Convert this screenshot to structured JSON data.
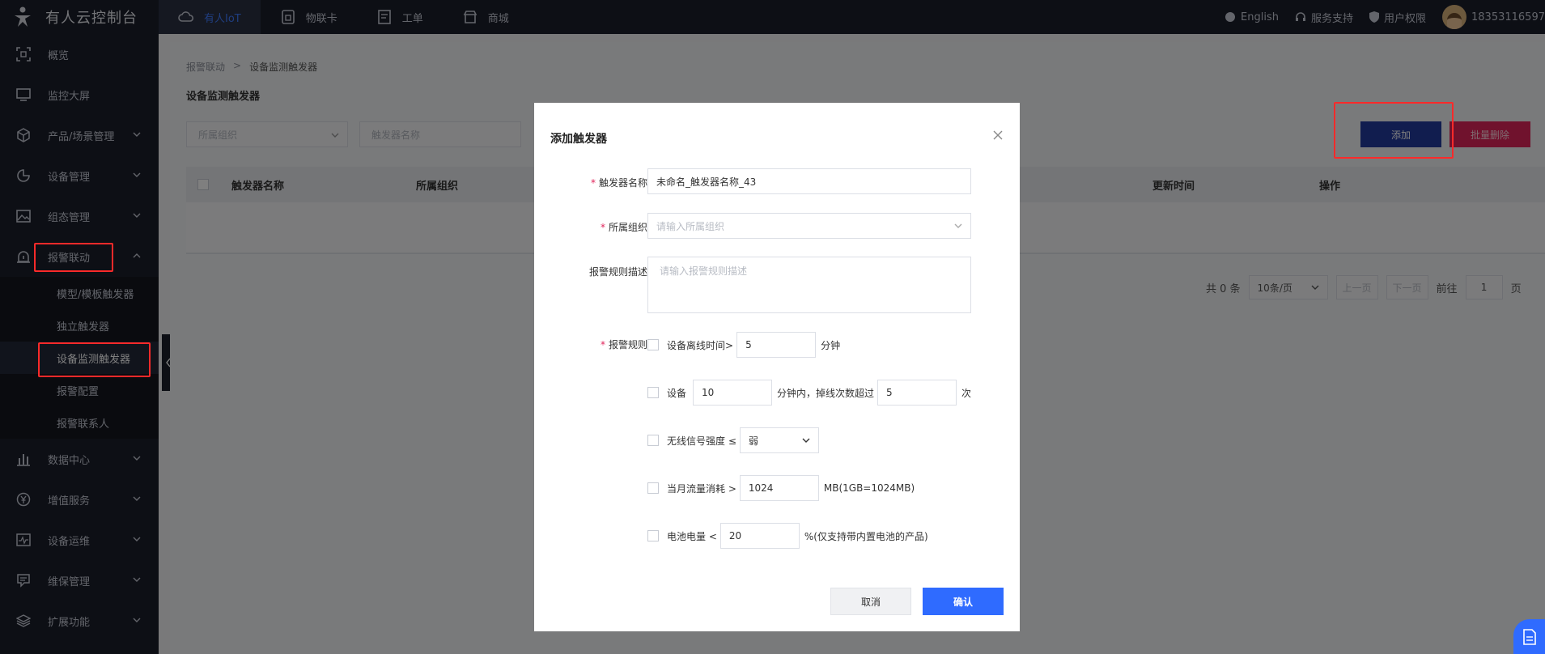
{
  "header": {
    "brand_title": "有人云控制台",
    "nav": [
      {
        "label": "有人IoT",
        "icon": "cloud-icon",
        "active": true
      },
      {
        "label": "物联卡",
        "icon": "sim-card-icon",
        "active": false
      },
      {
        "label": "工单",
        "icon": "ticket-icon",
        "active": false
      },
      {
        "label": "商城",
        "icon": "store-icon",
        "active": false
      }
    ],
    "right": {
      "language": "English",
      "support": "服务支持",
      "permission": "用户权限",
      "username": "18353116597"
    }
  },
  "sidebar": {
    "items": [
      {
        "label": "概览",
        "icon": "overview-icon"
      },
      {
        "label": "监控大屏",
        "icon": "monitor-icon"
      },
      {
        "label": "产品/场景管理",
        "icon": "cube-icon"
      },
      {
        "label": "设备管理",
        "icon": "pie-chart-icon"
      },
      {
        "label": "组态管理",
        "icon": "image-icon"
      },
      {
        "label": "报警联动",
        "icon": "alarm-icon"
      },
      {
        "label": "数据中心",
        "icon": "bar-chart-icon"
      },
      {
        "label": "增值服务",
        "icon": "yen-icon"
      },
      {
        "label": "设备运维",
        "icon": "pulse-icon"
      },
      {
        "label": "维保管理",
        "icon": "repair-icon"
      },
      {
        "label": "扩展功能",
        "icon": "layers-icon"
      }
    ],
    "alarm_sub": [
      {
        "label": "模型/模板触发器"
      },
      {
        "label": "独立触发器"
      },
      {
        "label": "设备监测触发器"
      },
      {
        "label": "报警配置"
      },
      {
        "label": "报警联系人"
      }
    ]
  },
  "main": {
    "breadcrumb": [
      "报警联动",
      "设备监测触发器"
    ],
    "breadcrumb_sep": ">",
    "title": "设备监测触发器",
    "filter_org_placeholder": "所属组织",
    "filter_name_placeholder": "触发器名称",
    "add_label": "添加",
    "batch_delete_label": "批量删除",
    "columns": [
      "触发器名称",
      "所属组织",
      "更新时间",
      "操作"
    ],
    "pagination": {
      "total": "共 0 条",
      "page_size": "10条/页",
      "prev": "上一页",
      "next": "下一页",
      "goto": "前往",
      "page": "1",
      "page_unit": "页"
    }
  },
  "modal": {
    "title": "添加触发器",
    "name_label": "触发器名称",
    "name_value": "未命名_触发器名称_43",
    "org_label": "所属组织",
    "org_placeholder": "请输入所属组织",
    "desc_label": "报警规则描述",
    "desc_placeholder": "请输入报警规则描述",
    "rules_label": "报警规则",
    "rules": {
      "offline_text": "设备离线时间>",
      "offline_value": "5",
      "offline_unit": "分钟",
      "drop_text1": "设备",
      "drop_minutes": "10",
      "drop_text2": "分钟内，掉线次数超过",
      "drop_count": "5",
      "drop_unit": "次",
      "signal_text": "无线信号强度 ≤",
      "signal_value": "弱",
      "traffic_text": "当月流量消耗 >",
      "traffic_value": "1024",
      "traffic_unit": "MB(1GB=1024MB)",
      "battery_text": "电池电量 <",
      "battery_value": "20",
      "battery_unit": "%(仅支持带内置电池的产品)"
    },
    "cancel_label": "取消",
    "confirm_label": "确认"
  },
  "colors": {
    "topbar": "#1b1e2b",
    "primary": "#2f6bff",
    "danger": "#e0245a",
    "highlight_box": "#ff2a2a"
  }
}
